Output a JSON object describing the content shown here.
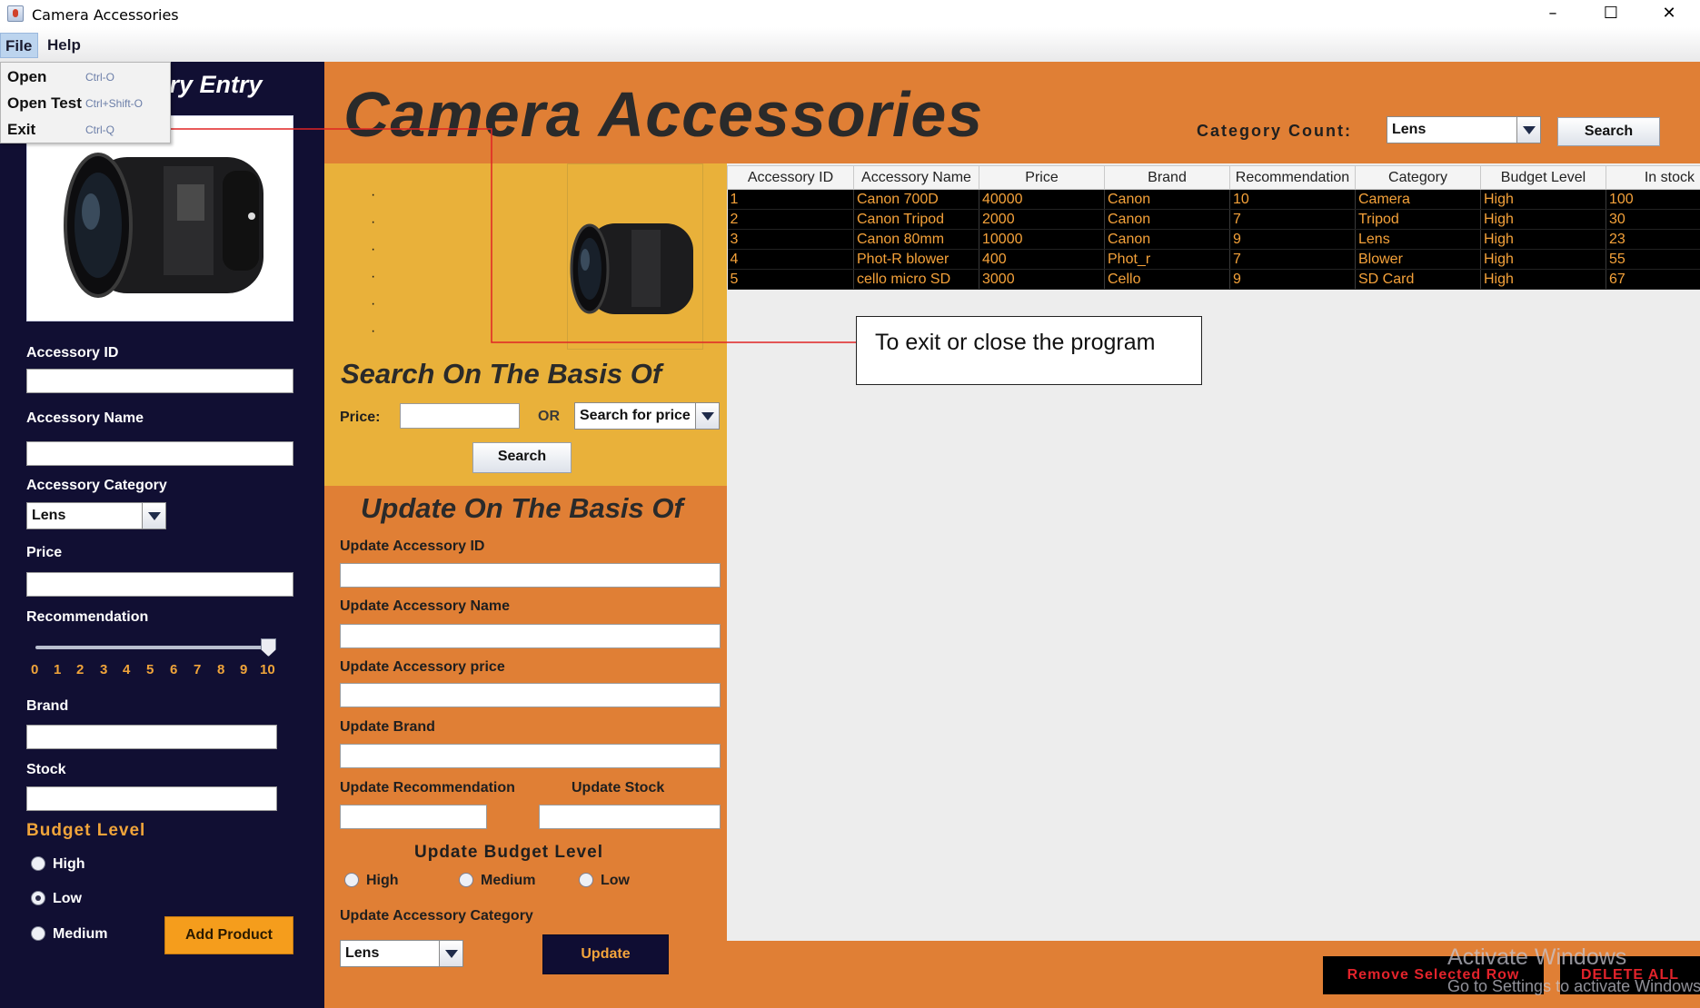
{
  "window": {
    "title": "Camera Accessories",
    "minimize": "–",
    "maximize": "☐",
    "close": "✕"
  },
  "menubar": {
    "file": "File",
    "help": "Help"
  },
  "file_menu": [
    {
      "label": "Open",
      "shortcut": "Ctrl-O"
    },
    {
      "label": "Open Test",
      "shortcut": "Ctrl+Shift-O"
    },
    {
      "label": "Exit",
      "shortcut": "Ctrl-Q"
    }
  ],
  "left": {
    "heading_visible": "ory Entry",
    "accessory_id_label": "Accessory ID",
    "accessory_name_label": "Accessory Name",
    "category_label": "Accessory Category",
    "category_value": "Lens",
    "price_label": "Price",
    "recommendation_label": "Recommendation",
    "recommendation_value": 10,
    "ticks": [
      "0",
      "1",
      "2",
      "3",
      "4",
      "5",
      "6",
      "7",
      "8",
      "9",
      "10"
    ],
    "brand_label": "Brand",
    "stock_label": "Stock",
    "budget_title": "Budget Level",
    "budget_options": [
      "High",
      "Low",
      "Medium"
    ],
    "budget_selected": "Low",
    "add_button": "Add Product"
  },
  "header": {
    "title": "Camera Accessories",
    "category_count_label": "Category Count:",
    "category_count_value": "Lens",
    "search_button": "Search"
  },
  "search_section": {
    "title": "Search On The Basis Of",
    "price_label": "Price:",
    "or_label": "OR",
    "price_combo": "Search for price",
    "search_button": "Search"
  },
  "update_section": {
    "title": "Update On The Basis Of",
    "id_label": "Update Accessory ID",
    "name_label": "Update Accessory Name",
    "price_label": "Update Accessory price",
    "brand_label": "Update Brand",
    "recommendation_label": "Update Recommendation",
    "stock_label": "Update Stock",
    "budget_title": "Update Budget Level",
    "budget_options": [
      "High",
      "Medium",
      "Low"
    ],
    "category_label": "Update Accessory Category",
    "category_value": "Lens",
    "update_button": "Update"
  },
  "table": {
    "columns": [
      "Accessory ID",
      "Accessory Name",
      "Price",
      "Brand",
      "Recommendation",
      "Category",
      "Budget Level",
      "In stock"
    ],
    "rows": [
      [
        "1",
        "Canon 700D",
        "40000",
        "Canon",
        "10",
        "Camera",
        "High",
        "100"
      ],
      [
        "2",
        "Canon Tripod",
        "2000",
        "Canon",
        "7",
        "Tripod",
        "High",
        "30"
      ],
      [
        "3",
        "Canon 80mm",
        "10000",
        "Canon",
        "9",
        "Lens",
        "High",
        "23"
      ],
      [
        "4",
        "Phot-R blower",
        "400",
        "Phot_r",
        "7",
        "Blower",
        "High",
        "55"
      ],
      [
        "5",
        "cello micro SD",
        "3000",
        "Cello",
        "9",
        "SD Card",
        "High",
        "67"
      ]
    ]
  },
  "callout": {
    "text": "To exit or close the program"
  },
  "bottom": {
    "remove_button": "Remove Selected Row",
    "delete_all_button": "DELETE ALL"
  },
  "watermark": {
    "line1": "Activate Windows",
    "line2": "Go to Settings to activate Windows."
  },
  "colors": {
    "navy": "#110f33",
    "orange": "#e07f35",
    "gold": "#e9b13a",
    "accent_text": "#f5a23a",
    "danger": "#e3232b"
  }
}
